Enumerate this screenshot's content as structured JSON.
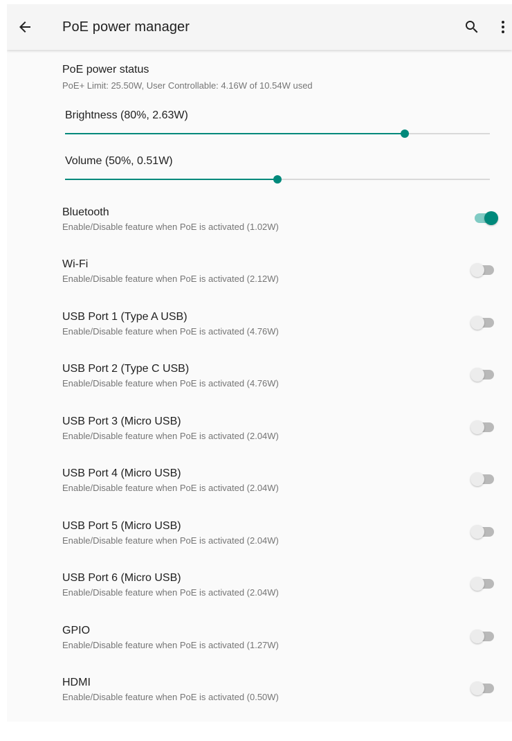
{
  "app_bar": {
    "title": "PoE power manager",
    "back_icon": "arrow-left-icon",
    "search_icon": "search-icon",
    "more_icon": "more-vert-icon"
  },
  "power_status": {
    "title": "PoE power status",
    "summary": "PoE+ Limit: 25.50W, User Controllable: 4.16W of 10.54W used"
  },
  "sliders": [
    {
      "label": "Brightness (80%, 2.63W)",
      "value": 0.8
    },
    {
      "label": "Volume (50%, 0.51W)",
      "value": 0.5
    }
  ],
  "toggles": [
    {
      "title": "Bluetooth",
      "summary": "Enable/Disable feature when PoE is activated (1.02W)",
      "on": true
    },
    {
      "title": "Wi-Fi",
      "summary": "Enable/Disable feature when PoE is activated (2.12W)",
      "on": false
    },
    {
      "title": "USB Port 1 (Type A USB)",
      "summary": "Enable/Disable feature when PoE is activated (4.76W)",
      "on": false
    },
    {
      "title": "USB Port 2 (Type C USB)",
      "summary": "Enable/Disable feature when PoE is activated (4.76W)",
      "on": false
    },
    {
      "title": "USB Port 3 (Micro USB)",
      "summary": "Enable/Disable feature when PoE is activated (2.04W)",
      "on": false
    },
    {
      "title": "USB Port 4 (Micro USB)",
      "summary": "Enable/Disable feature when PoE is activated (2.04W)",
      "on": false
    },
    {
      "title": "USB Port 5 (Micro USB)",
      "summary": "Enable/Disable feature when PoE is activated (2.04W)",
      "on": false
    },
    {
      "title": "USB Port 6 (Micro USB)",
      "summary": "Enable/Disable feature when PoE is activated (2.04W)",
      "on": false
    },
    {
      "title": "GPIO",
      "summary": "Enable/Disable feature when PoE is activated (1.27W)",
      "on": false
    },
    {
      "title": "HDMI",
      "summary": "Enable/Disable feature when PoE is activated (0.50W)",
      "on": false
    }
  ],
  "colors": {
    "accent": "#00897b",
    "accent_track": "#80cbc4",
    "off_track": "#b9b9b9",
    "off_thumb": "#ececec"
  }
}
